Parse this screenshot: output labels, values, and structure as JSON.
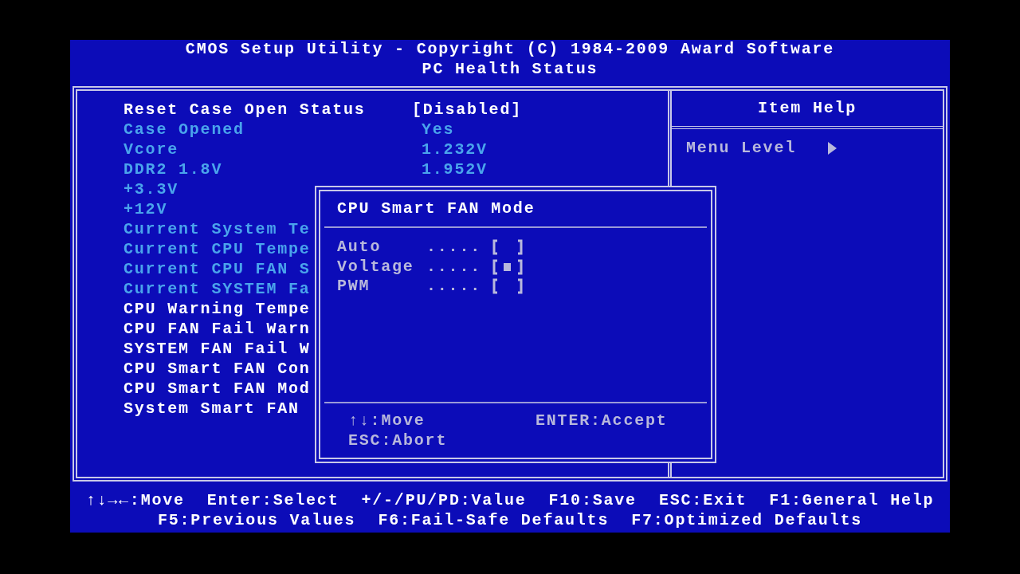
{
  "header": {
    "title": "CMOS Setup Utility - Copyright (C) 1984-2009 Award Software",
    "subtitle": "PC Health Status"
  },
  "items": [
    {
      "kind": "setting",
      "label": "Reset Case Open Status",
      "value": "[Disabled]"
    },
    {
      "kind": "info",
      "label": "Case Opened",
      "value": "Yes"
    },
    {
      "kind": "info",
      "label": "Vcore",
      "value": "1.232V"
    },
    {
      "kind": "info",
      "label": "DDR2 1.8V",
      "value": "1.952V"
    },
    {
      "kind": "info",
      "label": "+3.3V"
    },
    {
      "kind": "info",
      "label": "+12V"
    },
    {
      "kind": "info",
      "label": "Current System Te"
    },
    {
      "kind": "info",
      "label": "Current CPU Tempe"
    },
    {
      "kind": "info",
      "label": "Current CPU FAN S"
    },
    {
      "kind": "info",
      "label": "Current SYSTEM Fa"
    },
    {
      "kind": "setting",
      "label": "CPU Warning Tempe"
    },
    {
      "kind": "setting",
      "label": "CPU FAN Fail Warn"
    },
    {
      "kind": "setting",
      "label": "SYSTEM FAN Fail W"
    },
    {
      "kind": "setting",
      "label": "CPU Smart FAN Con"
    },
    {
      "kind": "setting",
      "label": "CPU Smart FAN Mod"
    },
    {
      "kind": "setting",
      "label": "System Smart FAN"
    }
  ],
  "help": {
    "title": "Item Help",
    "menu_level": "Menu Level"
  },
  "popup": {
    "title": "CPU Smart FAN Mode",
    "options": [
      {
        "label": "Auto",
        "leader": ".....",
        "checked": false
      },
      {
        "label": "Voltage",
        "leader": ".....",
        "checked": true
      },
      {
        "label": "PWM",
        "leader": ".....",
        "checked": false
      }
    ],
    "hints": [
      "↑↓:Move",
      "ENTER:Accept",
      "ESC:Abort"
    ]
  },
  "footer": {
    "line_1": [
      "↑↓→←:Move",
      "Enter:Select",
      "+/-/PU/PD:Value",
      "F10:Save",
      "ESC:Exit",
      "F1:General Help"
    ],
    "line_2": [
      "F5:Previous Values",
      "F6:Fail-Safe Defaults",
      "F7:Optimized Defaults"
    ]
  }
}
